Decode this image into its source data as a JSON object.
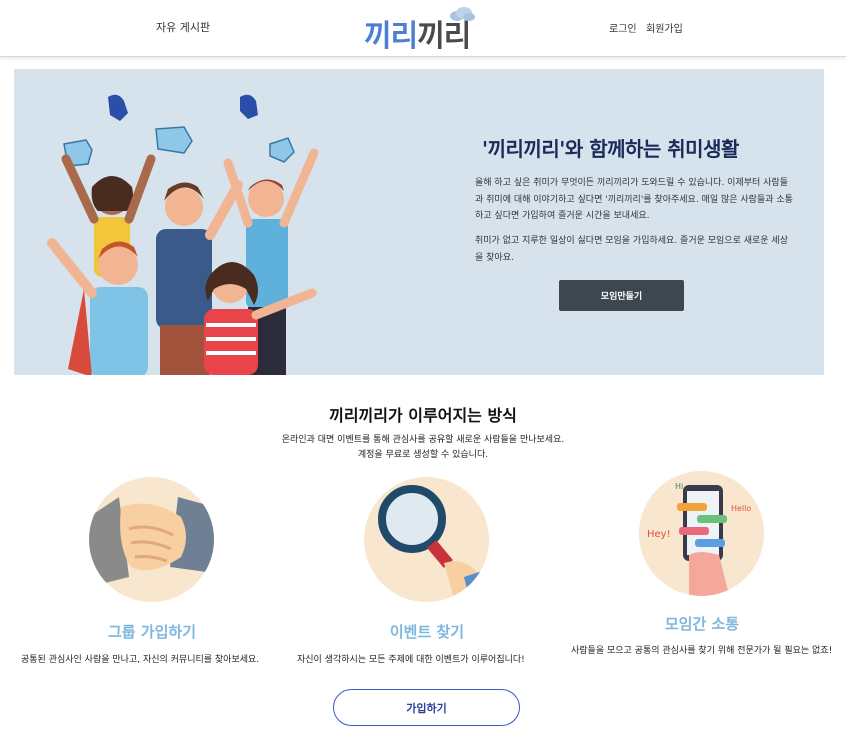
{
  "header": {
    "board_link": "자유 게시판",
    "logo_part1": "끼리",
    "logo_part2": "끼리",
    "login_link": "로그인",
    "signup_link": "회원가입"
  },
  "hero": {
    "title": "'끼리끼리'와 함께하는 취미생활",
    "paragraph1": "올해 하고 싶은 취미가 무엇이든 끼리끼리가 도와드릴 수 있습니다. 이제부터 사람들과 취미에 대해 이야기하고 싶다면 '끼리끼리'를 찾아주세요. 매일 많은 사람들과 소통하고 싶다면 가입하여 즐거운 시간을 보내세요.",
    "paragraph2": "취미가 없고 지루한 일상이 싫다면 모임을 가입하세요. 즐거운 모임으로 새로운 세상을 찾아요.",
    "button": "모임만들기"
  },
  "how": {
    "title": "끼리끼리가 이루어지는 방식",
    "subtitle1": "온라인과 대면 이벤트를 통해 관심사를 공유할 새로운 사람들을 만나보세요.",
    "subtitle2": "계정을 무료로 생성할 수 있습니다."
  },
  "features": [
    {
      "title": "그룹 가입하기",
      "description": "공통된 관심사인 사람을 만나고, 자신의 커뮤니티를 찾아보세요.",
      "icon": "handshake-icon"
    },
    {
      "title": "이벤트 찾기",
      "description": "자신이 생각하시는 모든 주제에 대한 이벤트가 이루어집니다!",
      "icon": "magnifier-icon"
    },
    {
      "title": "모임간 소통",
      "description": "사람들을 모으고 공통의 관심사를 찾기 위해 전문가가 될 필요는 없죠!",
      "icon": "chat-phone-icon"
    }
  ],
  "illustration_text": {
    "hey": "Hey!",
    "hi": "Hi",
    "hello": "Hello"
  },
  "join_button": "가입하기",
  "colors": {
    "hero_bg": "#d6e3ec",
    "logo_blue": "#4d7fd0",
    "feature_title": "#7eb7dd",
    "join_border": "#3e57c9",
    "hero_button": "#3d474f"
  }
}
